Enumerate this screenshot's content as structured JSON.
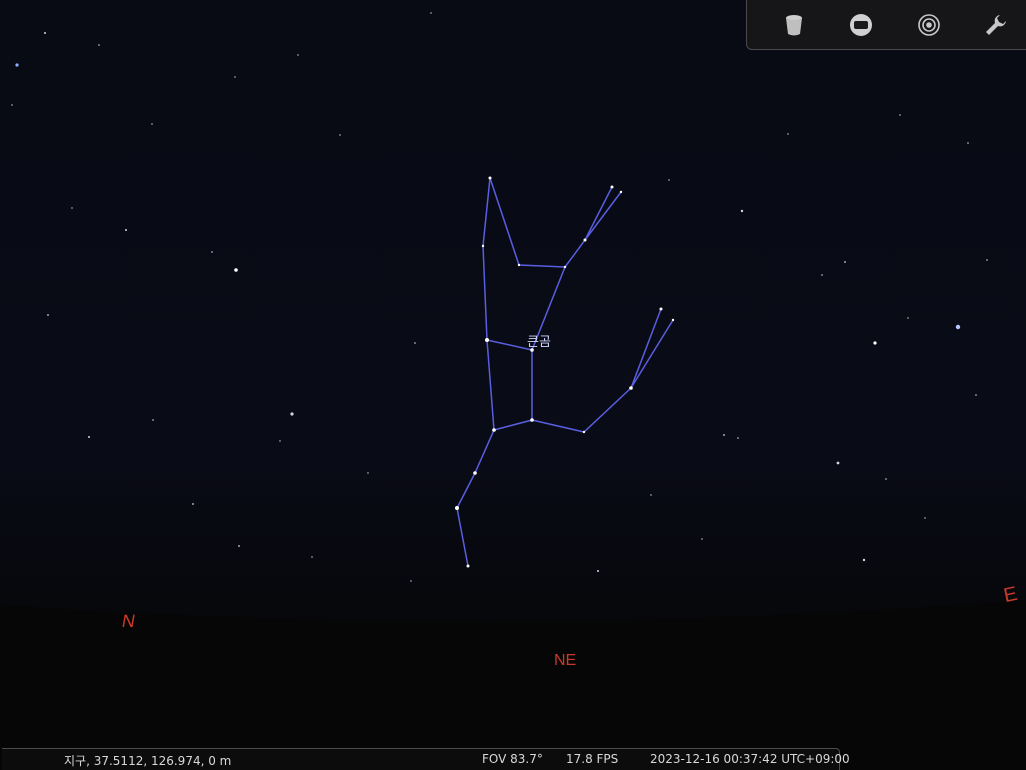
{
  "toolbar": {
    "buttons": [
      {
        "name": "landscape-button",
        "icon": "trash-can-icon"
      },
      {
        "name": "atmosphere-button",
        "icon": "rounded-square-icon"
      },
      {
        "name": "target-button",
        "icon": "target-icon"
      },
      {
        "name": "settings-button",
        "icon": "wrench-icon"
      }
    ]
  },
  "sky": {
    "constellation_label": "큰곰",
    "line_color": "#5a5ee0",
    "cardinal_color": "#c83a2a",
    "cardinals": {
      "north": "N",
      "northeast": "NE",
      "east": "E"
    }
  },
  "status": {
    "location": "지구, 37.5112, 126.974, 0 m",
    "fov": "FOV 83.7°",
    "fps": "17.8 FPS",
    "datetime": "2023-12-16 00:37:42 UTC+09:00"
  }
}
